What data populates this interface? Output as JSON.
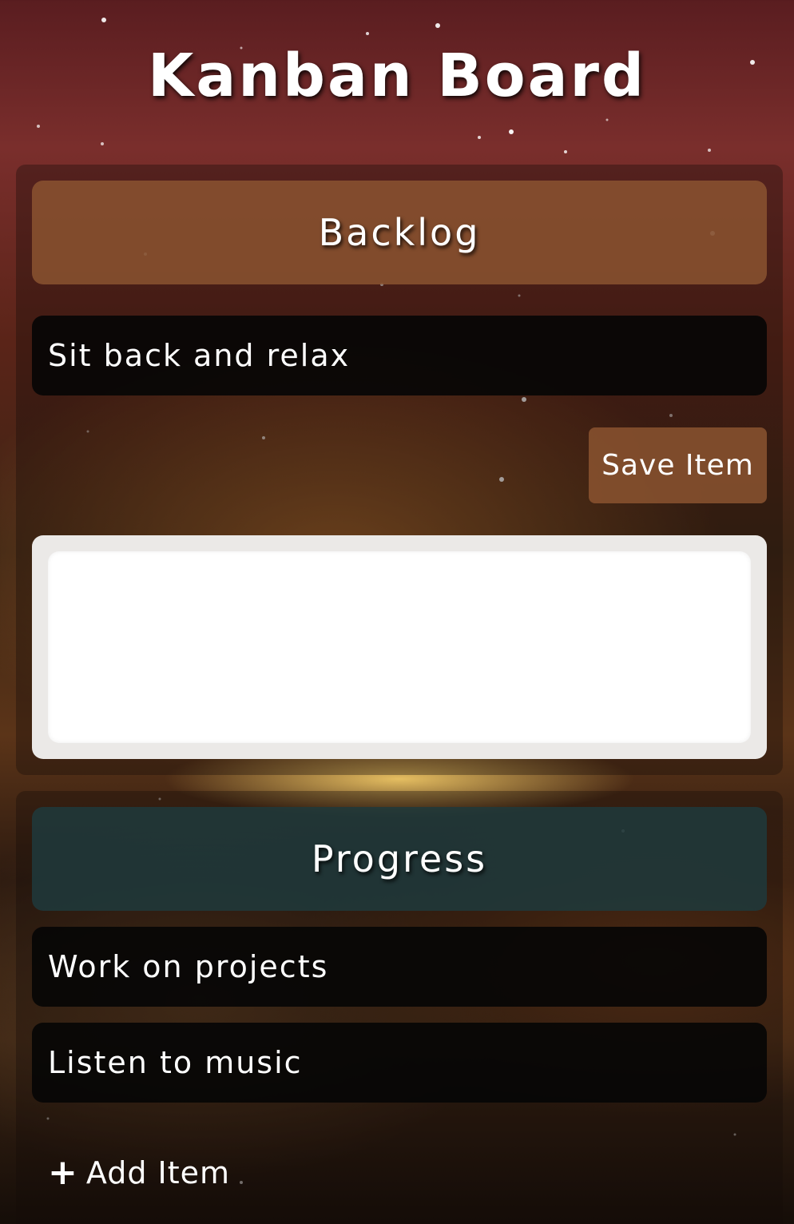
{
  "app": {
    "title": "Kanban Board"
  },
  "columns": {
    "backlog": {
      "title": "Backlog",
      "items": [
        "Sit back and relax"
      ],
      "save_label": "Save Item",
      "textarea_value": ""
    },
    "progress": {
      "title": "Progress",
      "items": [
        "Work on projects",
        "Listen to music"
      ],
      "add_label": "Add Item",
      "add_icon": "plus-icon"
    }
  },
  "colors": {
    "backlog_header": "#8b5430",
    "progress_header": "#1e3a3c",
    "card_background": "#050505",
    "text": "#ffffff"
  }
}
